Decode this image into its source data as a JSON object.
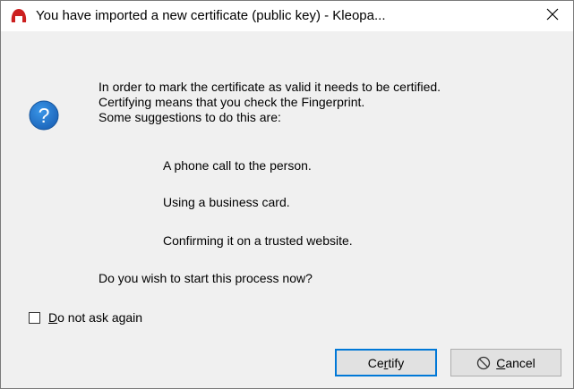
{
  "window": {
    "title": "You have imported a new certificate (public key) - Kleopa...",
    "app_icon": "kleopatra-app-icon",
    "close_icon": "close-icon"
  },
  "message": {
    "icon": "question-icon",
    "lines": [
      "In order to mark the certificate as valid it needs to be certified.",
      "Certifying means that you check the Fingerprint.",
      "Some suggestions to do this are:"
    ],
    "suggestions": [
      "A phone call to the person.",
      "Using a business card.",
      "Confirming it on a trusted website."
    ],
    "question": "Do you wish to start this process now?"
  },
  "checkbox": {
    "label_mnemonic": "D",
    "label_rest": "o not ask again",
    "checked": false
  },
  "buttons": {
    "certify": {
      "mnemonic_pre": "Ce",
      "mnemonic": "r",
      "rest": "tify"
    },
    "cancel": {
      "icon": "cancel-icon",
      "mnemonic": "C",
      "rest": "ancel"
    }
  },
  "colors": {
    "accent": "#0078d7",
    "dialog_bg": "#f0f0f0",
    "titlebar_bg": "#ffffff",
    "question_icon": "#1b71c7",
    "app_icon": "#cc1f1f"
  }
}
